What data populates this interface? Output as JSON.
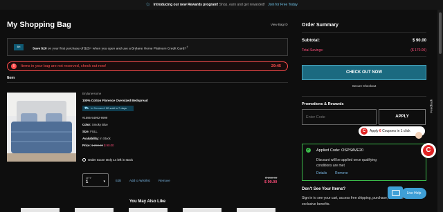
{
  "banner": {
    "intro": "Introducing our new Rewards program!",
    "sub": "Shop, earn and get rewarded!",
    "link": "Join for Free Today"
  },
  "page": {
    "title": "My Shopping Bag",
    "view_bag_id": "View Bag ID"
  },
  "promo": {
    "card_logo": "BH",
    "bold": "Save $20",
    "rest": " on your first purchase of $25+ when you open and use a Brylane Home Platinum Credit Card!*",
    "sup": "†"
  },
  "alert": {
    "icon": "!",
    "message": "Items in your bag are not reserved, check out now!",
    "timer": "29:45"
  },
  "item_section": {
    "heading": "Item"
  },
  "product": {
    "brand": "BrylaneHome",
    "name": "100% Cotton Florence Oversized Bedspread",
    "in_demand": "In Demand!",
    "sold": "92 sold in 7 days",
    "sku": "#1595-54992-9999",
    "color_label": "Color:",
    "color": "Smoky Blue",
    "size_label": "Size:",
    "size": "FULL",
    "availability_label": "Availability:",
    "availability": "In Stock",
    "price_label": "Price:",
    "price_old": "$ 250.00",
    "price_new": "$ 90.00",
    "order_soon": "Order Soon! Only 14 left in stock",
    "qty_label": "QTY",
    "qty_value": "1",
    "edit": "Edit",
    "add_to_wishlist": "Add to Wishlist",
    "remove": "Remove",
    "line_old": "$ 250.00",
    "line_new": "$ 90.00"
  },
  "you_may_also_like": "You May Also Like",
  "order_summary": {
    "title": "Order Summary",
    "subtotal_label": "Subtotal:",
    "subtotal": "$ 90.00",
    "savings_label": "Total Savings:",
    "savings": "($ 170.00)",
    "checkout": "CHECK OUT NOW",
    "secure": "Secure Checkout"
  },
  "promotions": {
    "title": "Promotions & Rewards",
    "placeholder": "Enter Code",
    "apply": "APPLY"
  },
  "coupon_popup": {
    "logo": "C",
    "pre": "Apply ",
    "count": "6",
    "post": " Coupons in 1 click"
  },
  "applied": {
    "code_text": "Applied Code: OSPSAVE20",
    "description": "Discount will be applied once qualifying conditions are met",
    "details": "Details",
    "remove": "Remove"
  },
  "extension_badge": "C",
  "feedback": "Feedback",
  "dont_see": {
    "title": "Don't See Your Items?",
    "text": "Sign in to see your cart, access free shipping, purchase, and more exclusive benefits."
  },
  "live_help": "Live Help",
  "colors": {
    "accent_teal": "#1b6a80",
    "alert_red": "#ff4d4d",
    "sale_pink": "#ff4d7a",
    "success_green": "#3cbf4c",
    "link_blue": "#7ab8e6"
  }
}
